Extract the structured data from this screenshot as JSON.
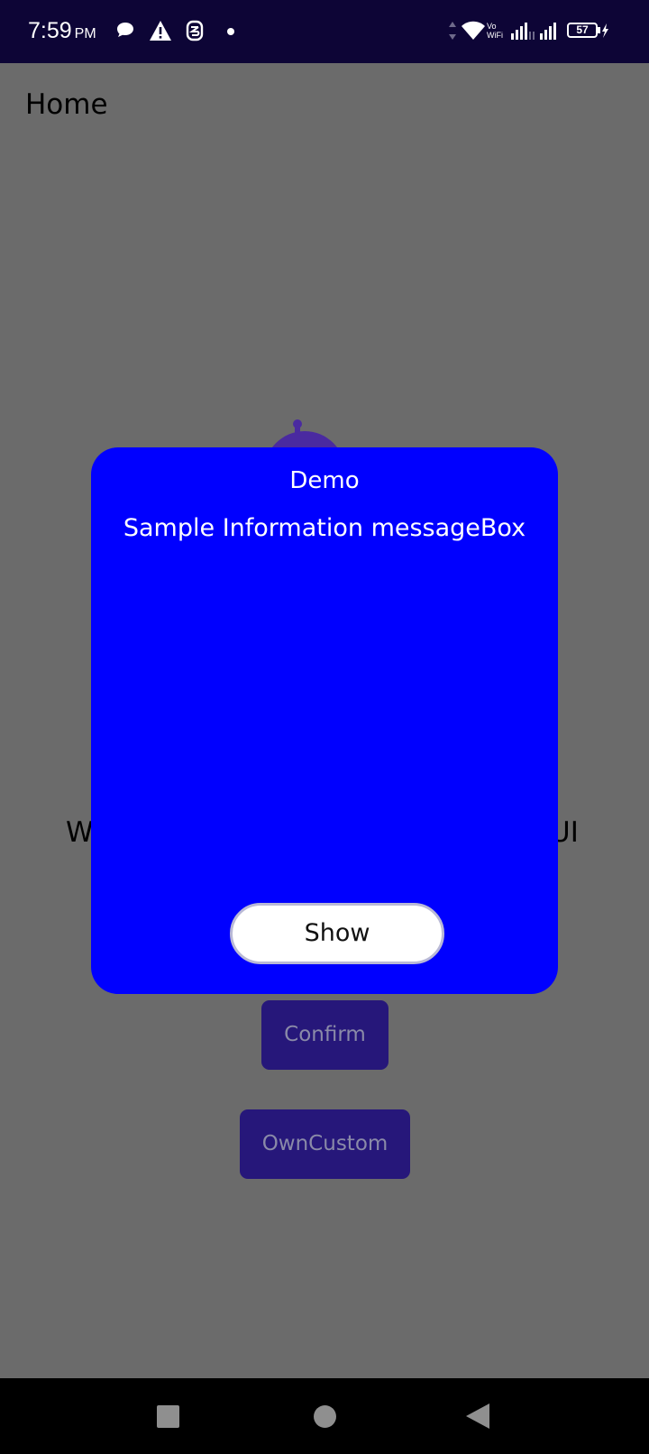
{
  "status_bar": {
    "time": "7:59",
    "ampm": "PM",
    "battery": "57",
    "vowifi_top": "Vo",
    "vowifi_bottom": "WiFi",
    "icons": [
      "chat-bubble-icon",
      "alert-triangle-icon",
      "app-notification-icon",
      "dot-icon",
      "data-arrows-icon",
      "wifi-icon",
      "signal-icon",
      "signal-icon",
      "battery-icon",
      "charging-icon"
    ]
  },
  "app": {
    "title": "Home"
  },
  "background": {
    "text_left": "W",
    "text_right": "UI",
    "confirm_label": "Confirm",
    "owncustom_label": "OwnCustom"
  },
  "dialog": {
    "title": "Demo",
    "message": "Sample Information messageBox",
    "button_label": "Show"
  },
  "nav_bar": {
    "icons": [
      "recent-apps-icon",
      "home-icon",
      "back-icon"
    ]
  },
  "colors": {
    "status_bar": "#0d0536",
    "overlay": "#6b6b6b",
    "dialog": "#0000ff",
    "bg_button": "#26177a"
  }
}
